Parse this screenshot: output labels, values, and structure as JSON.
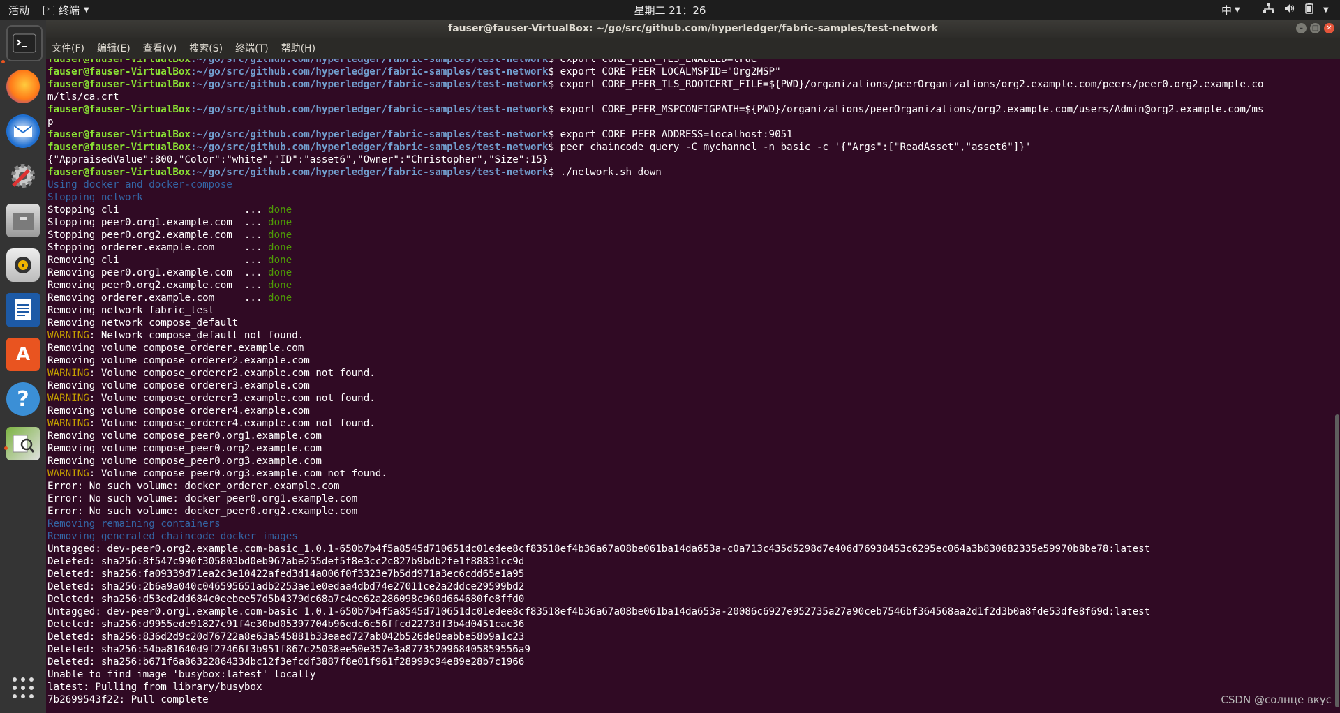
{
  "topbar": {
    "activities": "活动",
    "app_name": "终端",
    "clock": "星期二 21：26",
    "ime": "中"
  },
  "window": {
    "title": "fauser@fauser-VirtualBox: ~/go/src/github.com/hyperledger/fabric-samples/test-network"
  },
  "menu": [
    "文件(F)",
    "编辑(E)",
    "查看(V)",
    "搜索(S)",
    "终端(T)",
    "帮助(H)"
  ],
  "dock_icons": [
    "terminal-icon",
    "firefox-icon",
    "thunderbird-icon",
    "settings-icon",
    "files-icon",
    "rhythmbox-icon",
    "writer-icon",
    "software-icon",
    "help-icon",
    "tool-icon",
    "apps-grid-icon"
  ],
  "prompt": {
    "user": "fauser@fauser-VirtualBox",
    "path": ":~/go/src/github.com/hyperledger/fabric-samples/test-network",
    "sign": "$ "
  },
  "lines": [
    {
      "t": "prompt",
      "cmd": "export CORE_PEER_TLS_ENABLED=true"
    },
    {
      "t": "prompt",
      "cmd": "export CORE_PEER_LOCALMSPID=\"Org2MSP\""
    },
    {
      "t": "prompt",
      "cmd": "export CORE_PEER_TLS_ROOTCERT_FILE=${PWD}/organizations/peerOrganizations/org2.example.com/peers/peer0.org2.example.co"
    },
    {
      "t": "plain",
      "text": "m/tls/ca.crt"
    },
    {
      "t": "prompt",
      "cmd": "export CORE_PEER_MSPCONFIGPATH=${PWD}/organizations/peerOrganizations/org2.example.com/users/Admin@org2.example.com/ms"
    },
    {
      "t": "plain",
      "text": "p"
    },
    {
      "t": "prompt",
      "cmd": "export CORE_PEER_ADDRESS=localhost:9051"
    },
    {
      "t": "prompt",
      "cmd": "peer chaincode query -C mychannel -n basic -c '{\"Args\":[\"ReadAsset\",\"asset6\"]}'"
    },
    {
      "t": "plain",
      "text": "{\"AppraisedValue\":800,\"Color\":\"white\",\"ID\":\"asset6\",\"Owner\":\"Christopher\",\"Size\":15}"
    },
    {
      "t": "prompt",
      "cmd": "./network.sh down"
    },
    {
      "t": "info",
      "text": "Using docker and docker-compose"
    },
    {
      "t": "info",
      "text": "Stopping network"
    },
    {
      "t": "done",
      "text": "Stopping cli                     ... ",
      "status": "done"
    },
    {
      "t": "done",
      "text": "Stopping peer0.org1.example.com  ... ",
      "status": "done"
    },
    {
      "t": "done",
      "text": "Stopping peer0.org2.example.com  ... ",
      "status": "done"
    },
    {
      "t": "done",
      "text": "Stopping orderer.example.com     ... ",
      "status": "done"
    },
    {
      "t": "done",
      "text": "Removing cli                     ... ",
      "status": "done"
    },
    {
      "t": "done",
      "text": "Removing peer0.org1.example.com  ... ",
      "status": "done"
    },
    {
      "t": "done",
      "text": "Removing peer0.org2.example.com  ... ",
      "status": "done"
    },
    {
      "t": "done",
      "text": "Removing orderer.example.com     ... ",
      "status": "done"
    },
    {
      "t": "plain",
      "text": "Removing network fabric_test"
    },
    {
      "t": "plain",
      "text": "Removing network compose_default"
    },
    {
      "t": "warn",
      "label": "WARNING",
      "text": ": Network compose_default not found."
    },
    {
      "t": "plain",
      "text": "Removing volume compose_orderer.example.com"
    },
    {
      "t": "plain",
      "text": "Removing volume compose_orderer2.example.com"
    },
    {
      "t": "warn",
      "label": "WARNING",
      "text": ": Volume compose_orderer2.example.com not found."
    },
    {
      "t": "plain",
      "text": "Removing volume compose_orderer3.example.com"
    },
    {
      "t": "warn",
      "label": "WARNING",
      "text": ": Volume compose_orderer3.example.com not found."
    },
    {
      "t": "plain",
      "text": "Removing volume compose_orderer4.example.com"
    },
    {
      "t": "warn",
      "label": "WARNING",
      "text": ": Volume compose_orderer4.example.com not found."
    },
    {
      "t": "plain",
      "text": "Removing volume compose_peer0.org1.example.com"
    },
    {
      "t": "plain",
      "text": "Removing volume compose_peer0.org2.example.com"
    },
    {
      "t": "plain",
      "text": "Removing volume compose_peer0.org3.example.com"
    },
    {
      "t": "warn",
      "label": "WARNING",
      "text": ": Volume compose_peer0.org3.example.com not found."
    },
    {
      "t": "plain",
      "text": "Error: No such volume: docker_orderer.example.com"
    },
    {
      "t": "plain",
      "text": "Error: No such volume: docker_peer0.org1.example.com"
    },
    {
      "t": "plain",
      "text": "Error: No such volume: docker_peer0.org2.example.com"
    },
    {
      "t": "info",
      "text": "Removing remaining containers"
    },
    {
      "t": "info",
      "text": "Removing generated chaincode docker images"
    },
    {
      "t": "plain",
      "text": "Untagged: dev-peer0.org2.example.com-basic_1.0.1-650b7b4f5a8545d710651dc01edee8cf83518ef4b36a67a08be061ba14da653a-c0a713c435d5298d7e406d76938453c6295ec064a3b830682335e59970b8be78:latest"
    },
    {
      "t": "plain",
      "text": "Deleted: sha256:8f547c990f305803bd0eb967abe255def5f8e3cc2c827b9bdb2fe1f88831cc9d"
    },
    {
      "t": "plain",
      "text": "Deleted: sha256:fa09339d71ea2c3e10422afed3d14a006f0f3323e7b5dd971a3ec6cdd65e1a95"
    },
    {
      "t": "plain",
      "text": "Deleted: sha256:2b6a9a040c046595651adb2253ae1e0edaa4dbd74e27011ce2a2ddce29599bd2"
    },
    {
      "t": "plain",
      "text": "Deleted: sha256:d53ed2dd684c0eebee57d5b4379dc68a7c4ee62a286098c960d664680fe8ffd0"
    },
    {
      "t": "plain",
      "text": "Untagged: dev-peer0.org1.example.com-basic_1.0.1-650b7b4f5a8545d710651dc01edee8cf83518ef4b36a67a08be061ba14da653a-20086c6927e952735a27a90ceb7546bf364568aa2d1f2d3b0a8fde53dfe8f69d:latest"
    },
    {
      "t": "plain",
      "text": "Deleted: sha256:d9955ede91827c91f4e30bd05397704b96edc6c56ffcd2273df3b4d0451cac36"
    },
    {
      "t": "plain",
      "text": "Deleted: sha256:836d2d9c20d76722a8e63a545881b33eaed727ab042b526de0eabbe58b9a1c23"
    },
    {
      "t": "plain",
      "text": "Deleted: sha256:54ba81640d9f27466f3b951f867c25038ee50e357e3a8773520968405859556a9"
    },
    {
      "t": "plain",
      "text": "Deleted: sha256:b671f6a8632286433dbc12f3efcdf3887f8e01f961f28999c94e89e28b7c1966"
    },
    {
      "t": "plain",
      "text": "Unable to find image 'busybox:latest' locally"
    },
    {
      "t": "plain",
      "text": "latest: Pulling from library/busybox"
    },
    {
      "t": "plain",
      "text": "7b2699543f22: Pull complete"
    }
  ],
  "watermark": "CSDN @солнце вкус"
}
